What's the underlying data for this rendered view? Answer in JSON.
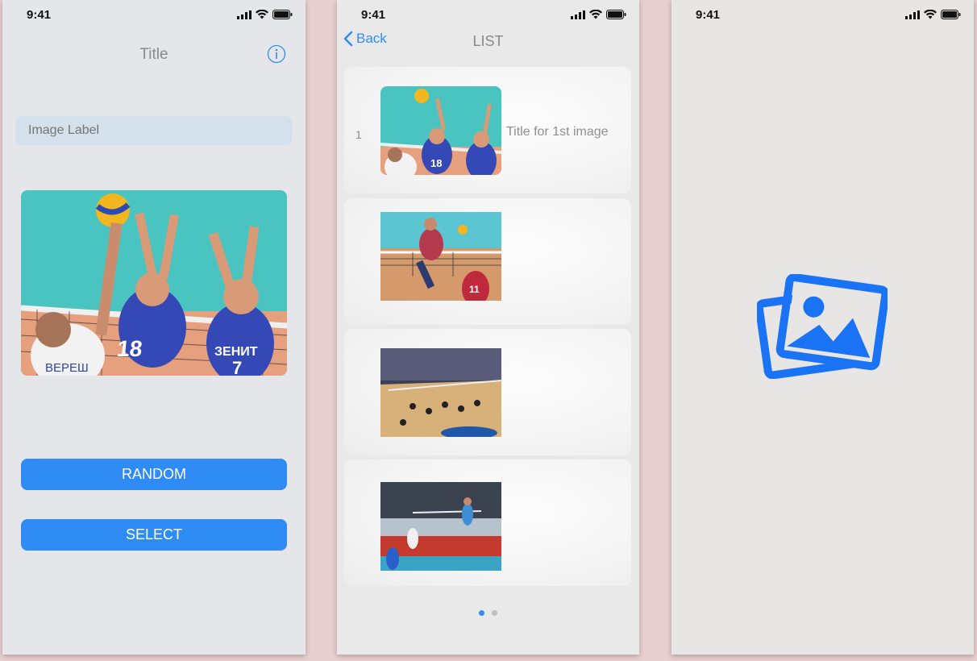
{
  "screens": [
    {
      "status": {
        "time": "9:41"
      },
      "title": "Title",
      "image_label_placeholder": "Image Label",
      "buttons": {
        "random": "RANDOM",
        "select": "SELECT"
      }
    },
    {
      "status": {
        "time": "9:41"
      },
      "nav": {
        "back": "Back",
        "title": "LIST"
      },
      "rows": [
        {
          "index": "1",
          "title": "Title for 1st image"
        },
        {
          "index": "",
          "title": ""
        },
        {
          "index": "",
          "title": ""
        },
        {
          "index": "",
          "title": ""
        }
      ],
      "page_dots": {
        "count": 2,
        "active": 0
      }
    },
    {
      "status": {
        "time": "9:41"
      }
    }
  ],
  "colors": {
    "accent": "#2F8CF5",
    "field_bg": "#D4E0EC",
    "dot_inactive": "#BDBDC2",
    "icon_blue": "#1A73F5"
  },
  "icons": [
    "info-icon",
    "chevron-left-icon",
    "image-gallery-icon",
    "signal-icon",
    "wifi-icon",
    "battery-icon"
  ]
}
